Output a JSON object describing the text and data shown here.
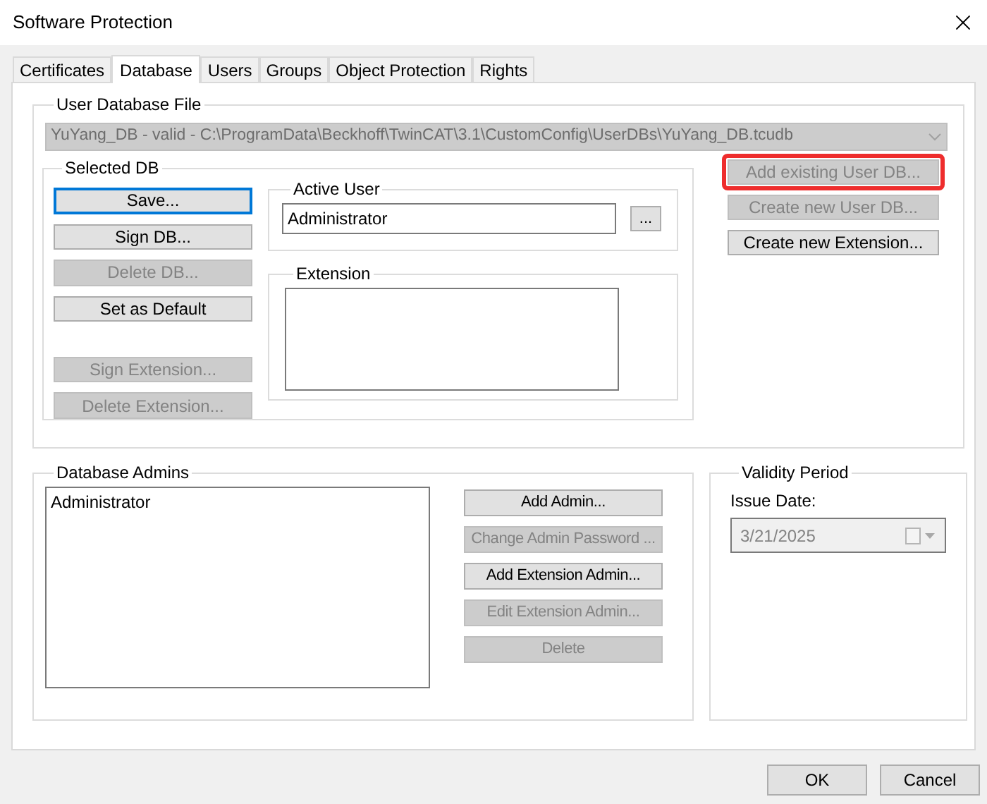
{
  "window": {
    "title": "Software Protection"
  },
  "tabs": [
    {
      "label": "Certificates",
      "selected": false
    },
    {
      "label": "Database",
      "selected": true
    },
    {
      "label": "Users",
      "selected": false
    },
    {
      "label": "Groups",
      "selected": false
    },
    {
      "label": "Object Protection",
      "selected": false
    },
    {
      "label": "Rights",
      "selected": false
    }
  ],
  "user_database_file": {
    "title": "User Database File",
    "file": "YuYang_DB - valid - C:\\ProgramData\\Beckhoff\\TwinCAT\\3.1\\CustomConfig\\UserDBs\\YuYang_DB.tcudb",
    "disabled": true
  },
  "selected_db": {
    "title": "Selected DB",
    "buttons": [
      {
        "label": "Save...",
        "disabled": false,
        "focused": true
      },
      {
        "label": "Sign DB...",
        "disabled": false,
        "focused": false
      },
      {
        "label": "Delete DB...",
        "disabled": true
      },
      {
        "label": "Set as Default",
        "disabled": false,
        "focused": false
      }
    ],
    "extension_buttons": [
      {
        "label": "Sign Extension...",
        "disabled": true
      },
      {
        "label": "Delete Extension...",
        "disabled": true
      }
    ]
  },
  "active_user": {
    "title": "Active User",
    "value": "Administrator",
    "browse_label": "..."
  },
  "extension": {
    "title": "Extension"
  },
  "db_actions": [
    {
      "label": "Add existing User DB...",
      "disabled": true,
      "highlighted": true
    },
    {
      "label": "Create new User DB...",
      "disabled": true,
      "highlighted": false
    },
    {
      "label": "Create new Extension...",
      "disabled": false,
      "highlighted": false
    }
  ],
  "database_admins": {
    "title": "Database Admins",
    "items": [
      "Administrator"
    ],
    "buttons": [
      {
        "label": "Add Admin...",
        "disabled": false
      },
      {
        "label": "Change Admin Password ...",
        "disabled": true
      },
      {
        "label": "Add Extension Admin...",
        "disabled": false
      },
      {
        "label": "Edit Extension Admin...",
        "disabled": true
      },
      {
        "label": "Delete",
        "disabled": true
      }
    ]
  },
  "validity_period": {
    "title": "Validity Period",
    "issue_date_label": "Issue Date:",
    "issue_date": "3/21/2025",
    "disabled": true
  },
  "footer_buttons": [
    "OK",
    "Cancel"
  ]
}
